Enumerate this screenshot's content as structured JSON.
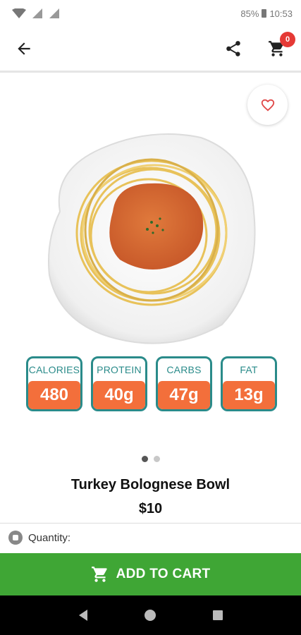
{
  "status_bar": {
    "battery": "85%",
    "time": "10:53"
  },
  "header": {
    "cart_count": "0"
  },
  "product": {
    "name": "Turkey Bolognese Bowl",
    "price": "$10",
    "image_slide": 1,
    "image_count": 2
  },
  "macros": [
    {
      "label": "CALORIES",
      "value": "480"
    },
    {
      "label": "PROTEIN",
      "value": "40g"
    },
    {
      "label": "CARBS",
      "value": "47g"
    },
    {
      "label": "FAT",
      "value": "13g"
    }
  ],
  "quantity": {
    "label": "Quantity:"
  },
  "actions": {
    "add_to_cart": "ADD TO CART"
  },
  "colors": {
    "accent_green": "#3fa635",
    "macro_teal": "#2a8b8a",
    "macro_orange": "#f36f3b",
    "badge_red": "#e53935"
  },
  "icons": [
    "back-arrow-icon",
    "share-icon",
    "cart-icon",
    "heart-icon",
    "cart-icon",
    "back-triangle-icon",
    "home-circle-icon",
    "recents-square-icon"
  ]
}
